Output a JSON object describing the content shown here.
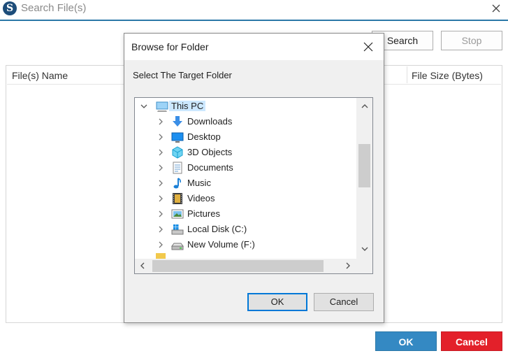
{
  "window": {
    "title": "Search File(s)",
    "logo_letter": "S",
    "search_label": "Search",
    "stop_label": "Stop",
    "ok_label": "OK",
    "cancel_label": "Cancel",
    "colors": {
      "accent": "#3489c3",
      "danger": "#e3202a",
      "title_rule": "#2b78a8"
    }
  },
  "file_list": {
    "columns": [
      "File(s) Name",
      "File Size (Bytes)"
    ]
  },
  "dialog": {
    "title": "Browse for Folder",
    "prompt": "Select The Target Folder",
    "ok_label": "OK",
    "cancel_label": "Cancel",
    "tree": [
      {
        "label": "This PC",
        "icon": "computer-icon",
        "selected": true,
        "expanded": true
      },
      {
        "label": "Downloads",
        "icon": "downloads-icon"
      },
      {
        "label": "Desktop",
        "icon": "desktop-icon"
      },
      {
        "label": "3D Objects",
        "icon": "3d-objects-icon"
      },
      {
        "label": "Documents",
        "icon": "documents-icon"
      },
      {
        "label": "Music",
        "icon": "music-icon"
      },
      {
        "label": "Videos",
        "icon": "videos-icon"
      },
      {
        "label": "Pictures",
        "icon": "pictures-icon"
      },
      {
        "label": "Local Disk (C:)",
        "icon": "windows-drive-icon"
      },
      {
        "label": "New Volume (F:)",
        "icon": "drive-icon"
      }
    ]
  }
}
